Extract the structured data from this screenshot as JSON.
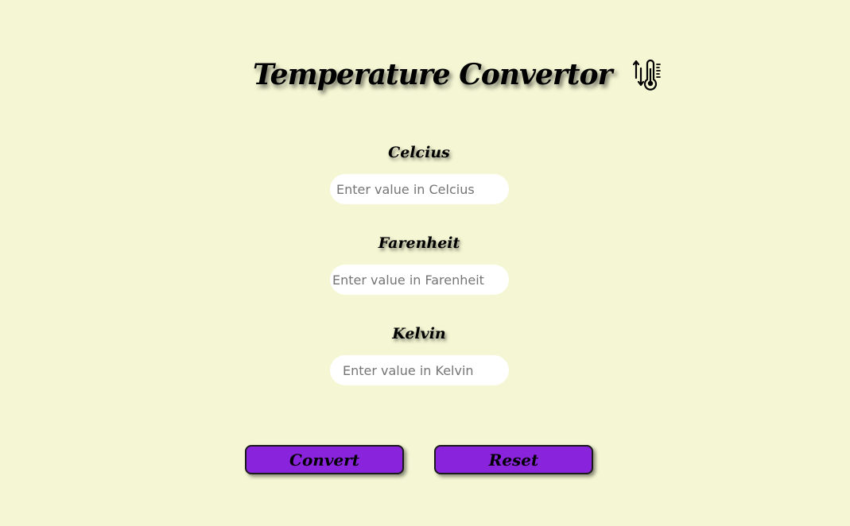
{
  "header": {
    "title": "Temperature Convertor",
    "icon": "thermometer-icon"
  },
  "fields": [
    {
      "label": "Celcius",
      "placeholder": "Enter value in Celcius",
      "value": ""
    },
    {
      "label": "Farenheit",
      "placeholder": "Enter value in Farenheit",
      "value": ""
    },
    {
      "label": "Kelvin",
      "placeholder": "Enter value in Kelvin",
      "value": ""
    }
  ],
  "buttons": {
    "convert_label": "Convert",
    "reset_label": "Reset"
  },
  "colors": {
    "background": "#f5f7d4",
    "button": "#8a24dc",
    "input": "#ffffff"
  }
}
